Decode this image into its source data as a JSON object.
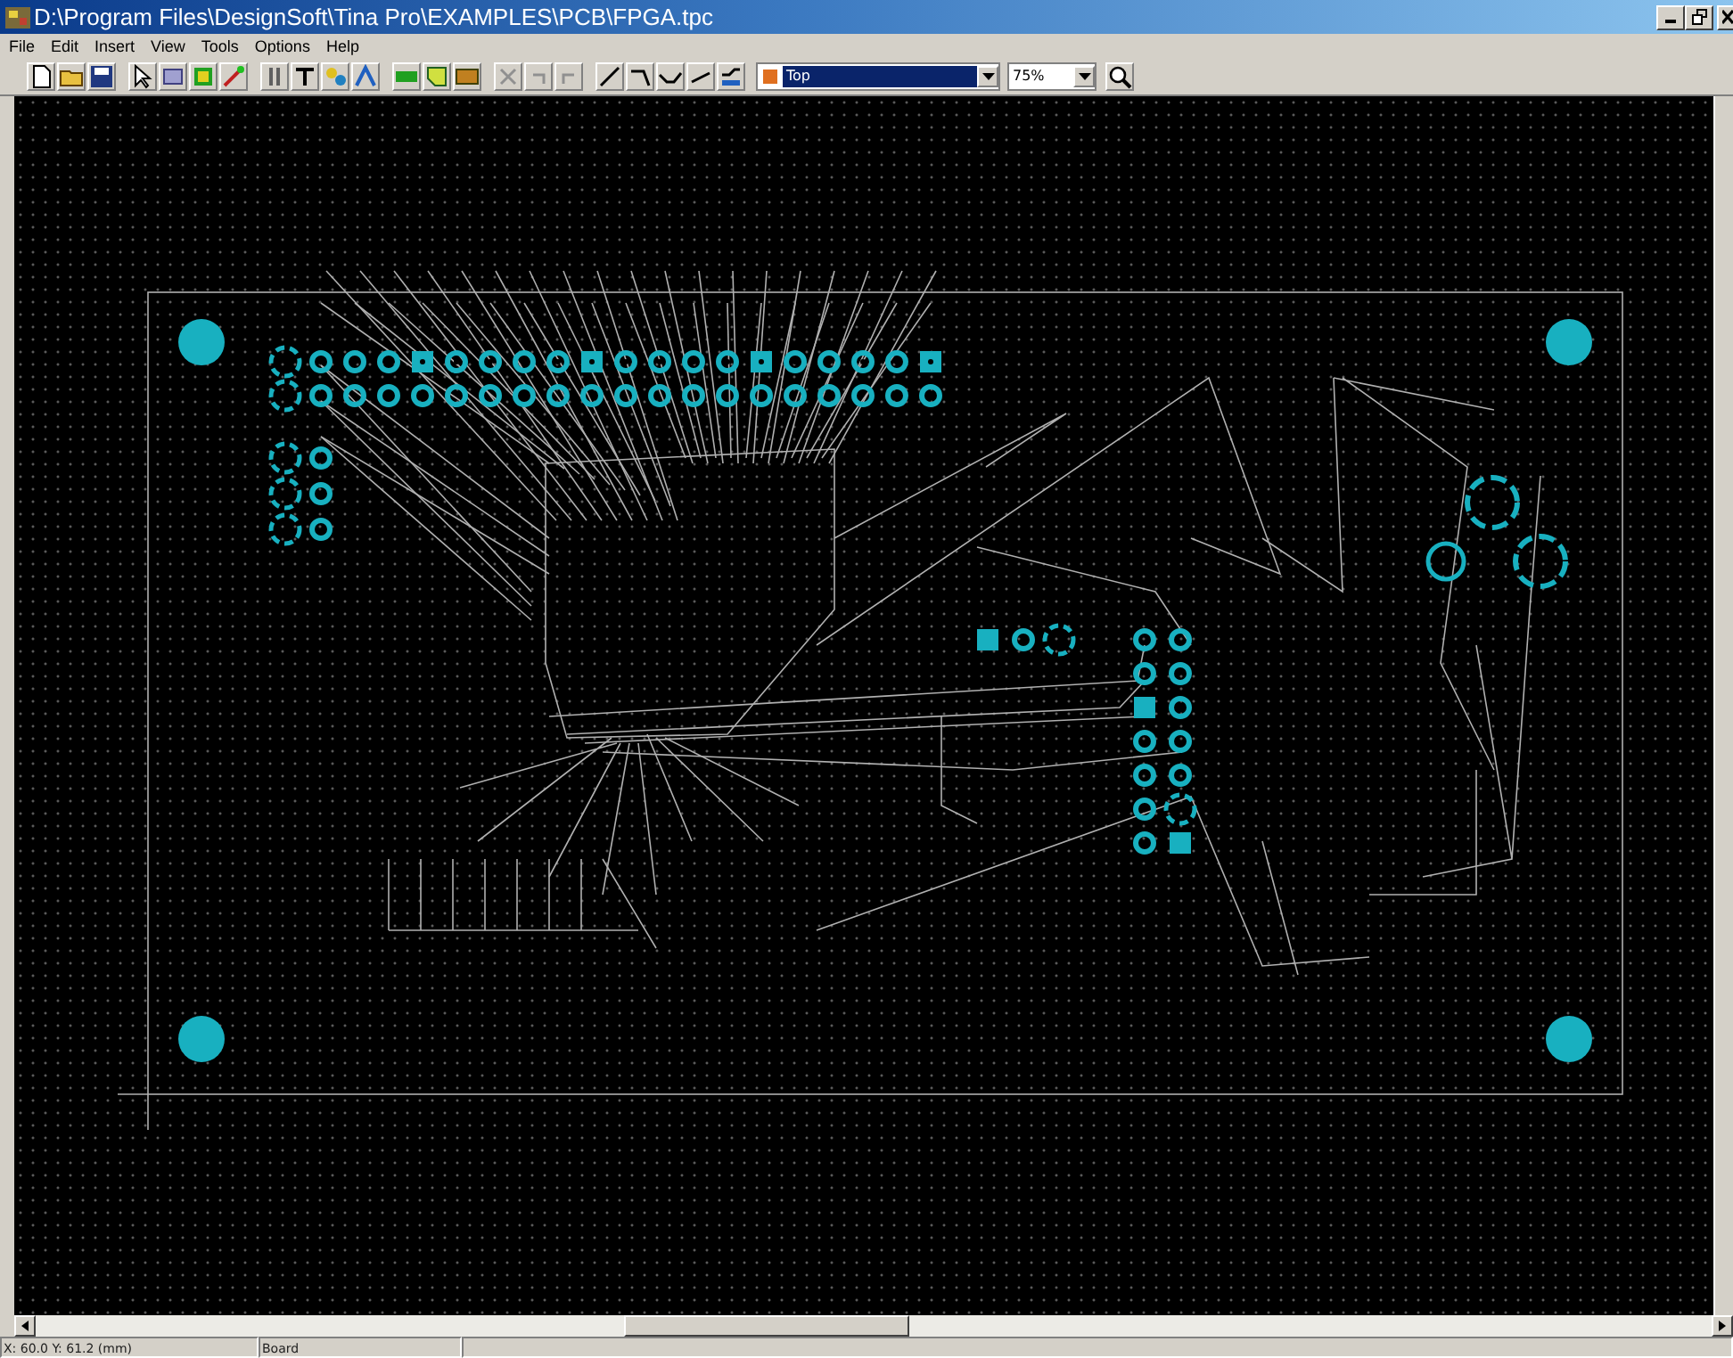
{
  "window": {
    "title": "D:\\Program Files\\DesignSoft\\Tina Pro\\EXAMPLES\\PCB\\FPGA.tpc"
  },
  "menu": [
    "File",
    "Edit",
    "Insert",
    "View",
    "Tools",
    "Options",
    "Help"
  ],
  "toolbar": {
    "layer": "Top",
    "zoom": "75%"
  },
  "status_bar": {
    "coordinates": "X: 60.0  Y: 61.2 (mm)",
    "mode": "Board"
  }
}
